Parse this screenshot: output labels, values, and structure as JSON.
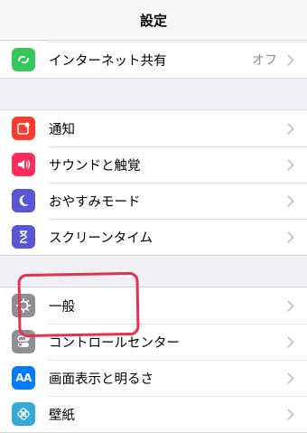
{
  "header": {
    "title": "設定"
  },
  "colors": {
    "hotspot": "#34c759",
    "notifications": "#ff3b30",
    "sounds": "#ff2d55",
    "dnd": "#5856d6",
    "screentime": "#5856d6",
    "general": "#8e8e93",
    "control_center": "#8e8e93",
    "display": "#007aff",
    "wallpaper": "#34aadc",
    "annotation": "#e4314f"
  },
  "groups": [
    {
      "items": [
        {
          "label": "インターネット共有",
          "detail": "オフ",
          "icon": "link-icon"
        }
      ]
    },
    {
      "items": [
        {
          "label": "通知",
          "icon": "notification-icon"
        },
        {
          "label": "サウンドと触覚",
          "icon": "speaker-icon"
        },
        {
          "label": "おやすみモード",
          "icon": "moon-icon"
        },
        {
          "label": "スクリーンタイム",
          "icon": "hourglass-icon"
        }
      ]
    },
    {
      "items": [
        {
          "label": "一般",
          "icon": "gear-icon"
        },
        {
          "label": "コントロールセンター",
          "icon": "toggle-icon"
        },
        {
          "label": "画面表示と明るさ",
          "icon": "text-size-icon",
          "icon_text": "AA"
        },
        {
          "label": "壁紙",
          "icon": "flower-icon"
        }
      ]
    }
  ]
}
